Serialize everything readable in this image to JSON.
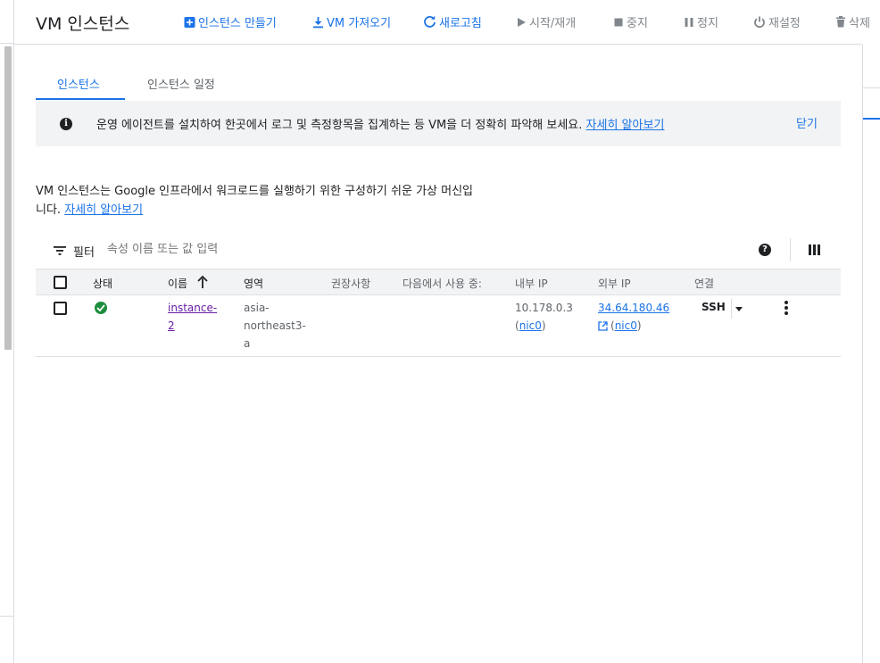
{
  "header": {
    "title": "VM 인스턴스",
    "actions": {
      "create": "인스턴스 만들기",
      "import": "VM 가져오기",
      "refresh": "새로고침",
      "start": "시작/재개",
      "stop": "중지",
      "suspend": "정지",
      "reset": "재설정",
      "delete": "삭제"
    }
  },
  "tabs": {
    "instances": "인스턴스",
    "schedule": "인스턴스 일정"
  },
  "banner": {
    "text": "운영 에이전트를 설치하여 한곳에서 로그 및 측정항목을 집계하는 등 VM을 더 정확히 파악해 보세요.",
    "link": "자세히 알아보기",
    "close": "닫기"
  },
  "description": {
    "line1": "VM 인스턴스는 Google 인프라에서 워크로드를 실행하기 위한 구성하기 쉬운 가상 머신입",
    "line2_prefix": "니다.",
    "link": "자세히 알아보기"
  },
  "filter": {
    "label": "필터",
    "placeholder": "속성 이름 또는 값 입력"
  },
  "table": {
    "headers": {
      "status": "상태",
      "name": "이름",
      "zone": "영역",
      "recommendation": "권장사항",
      "in_use_by": "다음에서 사용 중:",
      "internal_ip": "내부 IP",
      "external_ip": "외부 IP",
      "connect": "연결"
    },
    "rows": [
      {
        "name_line1": "instance-",
        "name_line2": "2",
        "zone_line1": "asia-",
        "zone_line2": "northeast3-",
        "zone_line3": "a",
        "internal_ip": "10.178.0.3",
        "internal_nic": "nic0",
        "external_ip": "34.64.180.46",
        "external_nic": "nic0",
        "connect": "SSH"
      }
    ]
  },
  "colors": {
    "accent": "#1a73e8",
    "status_ok": "#1e8e3e",
    "visited_link": "#681da8"
  }
}
